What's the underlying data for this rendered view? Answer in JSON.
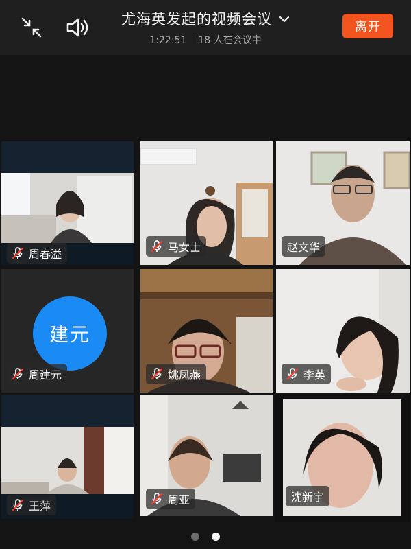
{
  "header": {
    "title": "尤海英发起的视频会议",
    "duration": "1:22:51",
    "participants": "18 人在会议中",
    "leave_label": "离开",
    "accent": "#f2541f"
  },
  "tiles": [
    {
      "name": "周春溢",
      "muted": true,
      "video": true
    },
    {
      "name": "马女士",
      "muted": true,
      "video": true
    },
    {
      "name": "赵文华",
      "muted": false,
      "video": true
    },
    {
      "name": "周建元",
      "muted": true,
      "video": false,
      "avatar_text": "建元",
      "avatar_color": "#1a8bf5"
    },
    {
      "name": "姚凤燕",
      "muted": true,
      "video": true
    },
    {
      "name": "李英",
      "muted": true,
      "video": true
    },
    {
      "name": "王萍",
      "muted": true,
      "video": true
    },
    {
      "name": "周亚",
      "muted": true,
      "video": true
    },
    {
      "name": "沈新宇",
      "muted": false,
      "video": true,
      "active_speaker": true,
      "active_color": "#1fbf45"
    }
  ],
  "pager": {
    "pages": 2,
    "current": 2
  },
  "icons": [
    "collapse-icon",
    "speaker-icon",
    "chevron-down-icon",
    "mic-off-icon"
  ]
}
